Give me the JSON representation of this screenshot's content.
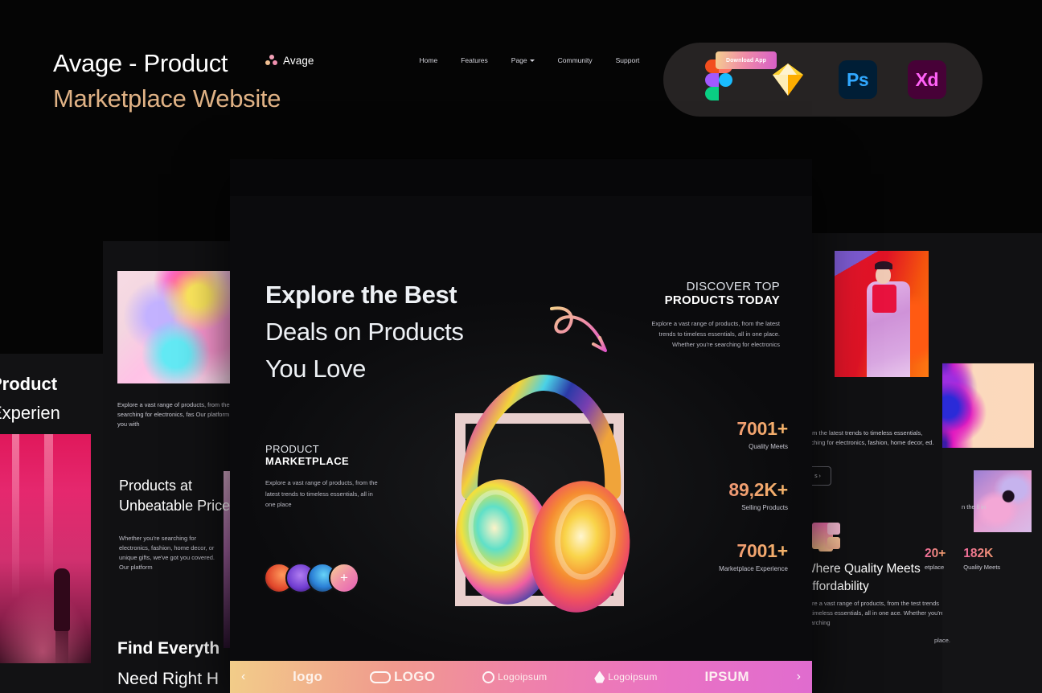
{
  "header": {
    "title_line1": "Avage - Product",
    "title_line2": "Marketplace Website",
    "apps": [
      {
        "name": "figma-icon",
        "label": ""
      },
      {
        "name": "sketch-icon",
        "label": ""
      },
      {
        "name": "photoshop-icon",
        "label": "Ps"
      },
      {
        "name": "xd-icon",
        "label": "Xd"
      }
    ]
  },
  "mockup": {
    "nav": {
      "brand": "Avage",
      "links": [
        "Home",
        "Features",
        "Page",
        "Community",
        "Support"
      ],
      "cta": "Download App"
    },
    "hero": {
      "line1": "Explore the Best",
      "line2": "Deals on Products",
      "line3": "You Love"
    },
    "discover": {
      "kicker1": "DISCOVER TOP",
      "kicker2": "PRODUCTS TODAY",
      "body": "Explore a vast range of products, from the latest trends to timeless essentials, all in one place. Whether you're searching for electronics"
    },
    "marketplace": {
      "kicker1": "PRODUCT",
      "kicker2": "MARKETPLACE",
      "body": "Explore a vast range of products, from the latest trends to timeless essentials, all in one place"
    },
    "avatar_plus": "+",
    "stats": [
      {
        "number": "7001+",
        "label": "Quality Meets"
      },
      {
        "number": "89,2K+",
        "label": "Selling Products"
      },
      {
        "number": "7001+",
        "label": "Marketplace Experience"
      }
    ],
    "logos": [
      {
        "prev_arrow": "‹"
      },
      {
        "text": "logo"
      },
      {
        "text": "LOGO"
      },
      {
        "text": "Logoipsum"
      },
      {
        "text": "Logoipsum"
      },
      {
        "text": "IPSUM"
      },
      {
        "next_arrow": "›"
      }
    ],
    "logo_items": [
      "logo",
      "LOGO",
      "Logoipsum",
      "Logoipsum",
      "IPSUM"
    ],
    "prev_arrow": "‹",
    "next_arrow": "›"
  },
  "left_panel": {
    "far_title_bold": "Product",
    "far_title_rest": "Experien",
    "body_top": "Explore a vast range of products, from the lat Whether you're searching for electronics, fas Our platform is designed to provide you with",
    "card_heading": "Products at Unbeatable Prices",
    "card_body": "Whether you're searching for electronics, fashion, home decor, or unique gifts, we've got you covered. Our platform",
    "find_bold": "Find Everyth",
    "find_rest": "Need Right H"
  },
  "right_panel": {
    "body_top": "om the latest trends to timeless essentials, rching for electronics, fashion, home decor, ed.",
    "button_label": "s ›",
    "heading": "Where Quality Meets Affordability",
    "body": "plore a vast range of products, from the test trends to timeless essentials, all in one ace. Whether you're searching",
    "tail1": "n the  ll in",
    "tail2": "place.",
    "stats": [
      {
        "number": "20+",
        "label": "etplace"
      },
      {
        "number": "182K",
        "label": "Quality Meets"
      }
    ]
  },
  "colors": {
    "accent_gold": "#e0b285",
    "gradient_start": "#f5cf8f",
    "gradient_mid": "#ef8aa8",
    "gradient_end": "#d65fc8",
    "page_bg": "#050505",
    "panel_bg": "#111113"
  }
}
